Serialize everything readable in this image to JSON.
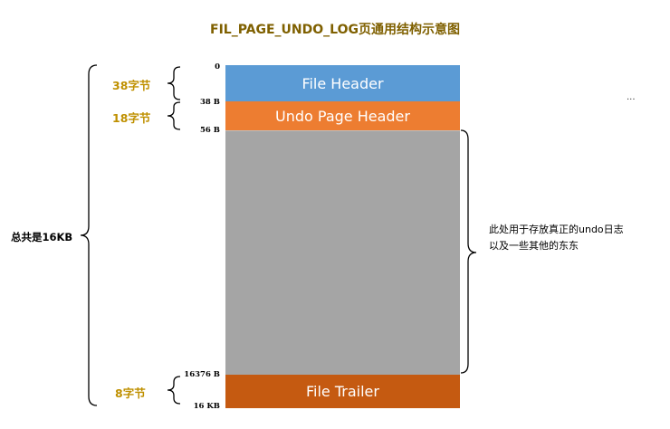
{
  "title": "FIL_PAGE_UNDO_LOG页通用结构示意图",
  "blocks": {
    "file_header": "File Header",
    "undo_page_header": "Undo Page Header",
    "body": "",
    "file_trailer": "File Trailer"
  },
  "offsets": {
    "o0": "0",
    "o38": "38 B",
    "o56": "56 B",
    "o16376": "16376 B",
    "o16k": "16 KB"
  },
  "sizes": {
    "file_header": "38字节",
    "undo_page_header": "18字节",
    "file_trailer": "8字节"
  },
  "total": "总共是16KB",
  "description": {
    "line1": "此处用于存放真正的undo日志",
    "line2": "以及一些其他的东东"
  },
  "ellipsis": "...",
  "colors": {
    "file_header": "#5b9bd5",
    "undo_page_header": "#ed7d31",
    "body": "#a5a5a5",
    "file_trailer": "#c55a11",
    "title": "#7f6000",
    "size_label": "#bf9000"
  }
}
